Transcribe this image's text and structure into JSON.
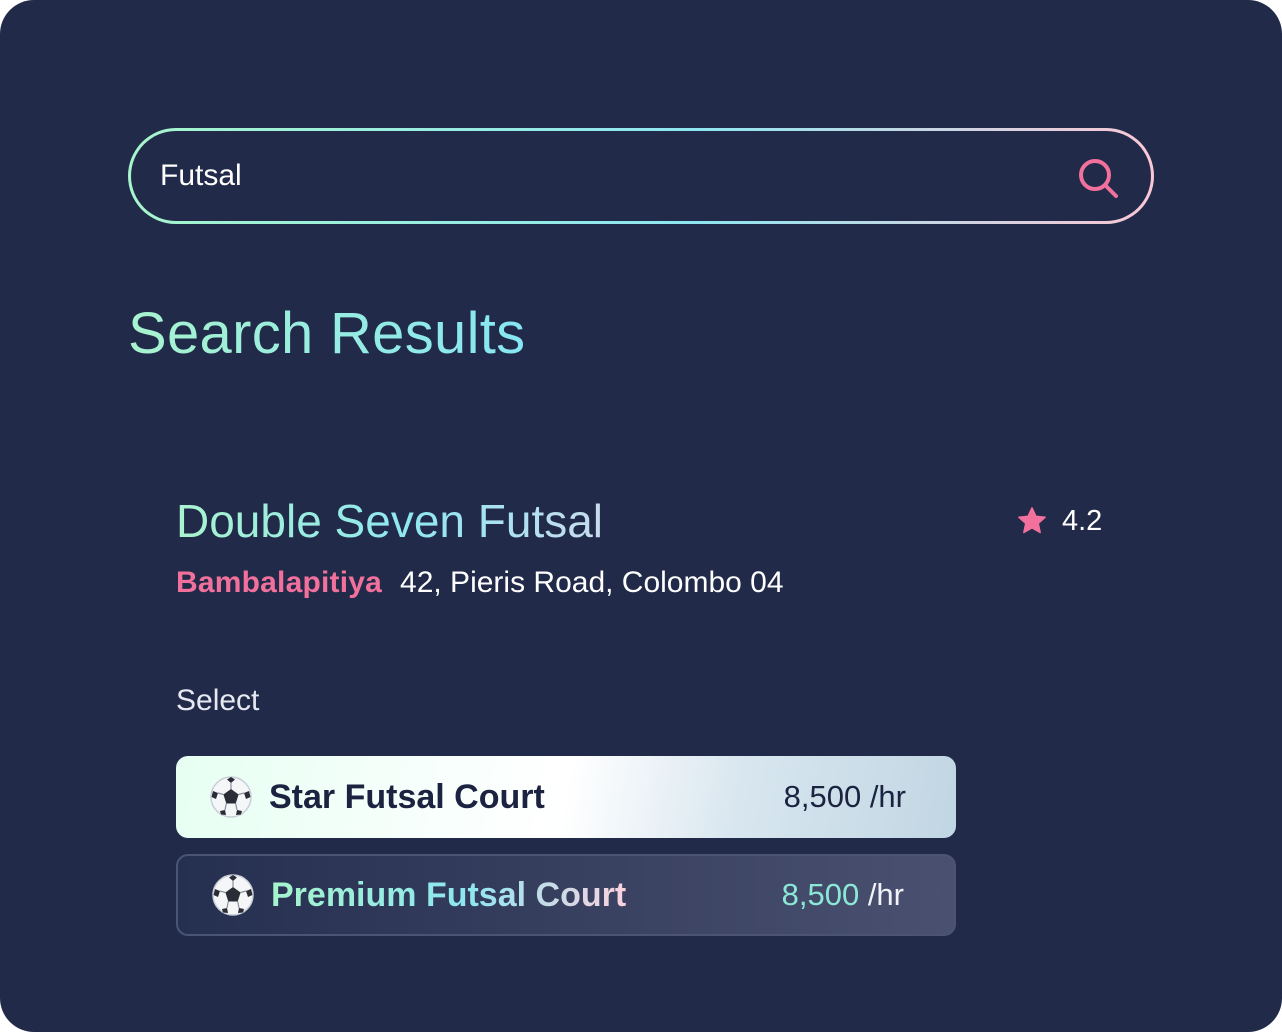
{
  "search": {
    "value": "Futsal"
  },
  "heading": "Search Results",
  "venue": {
    "name": "Double Seven Futsal",
    "rating": "4.2",
    "area": "Bambalapitiya",
    "address": "42, Pieris Road, Colombo 04"
  },
  "select_label": "Select",
  "courts": [
    {
      "name": "Star Futsal Court",
      "price": "8,500",
      "unit": "/hr",
      "icon": "soccer-ball-icon",
      "selected": true
    },
    {
      "name": "Premium Futsal Court",
      "price": "8,500",
      "unit": "/hr",
      "icon": "soccer-ball-icon",
      "selected": false
    }
  ],
  "colors": {
    "background": "#212a48",
    "accent_pink": "#f2709c",
    "accent_mint": "#a8f3cf",
    "accent_cyan": "#86e6f2"
  }
}
